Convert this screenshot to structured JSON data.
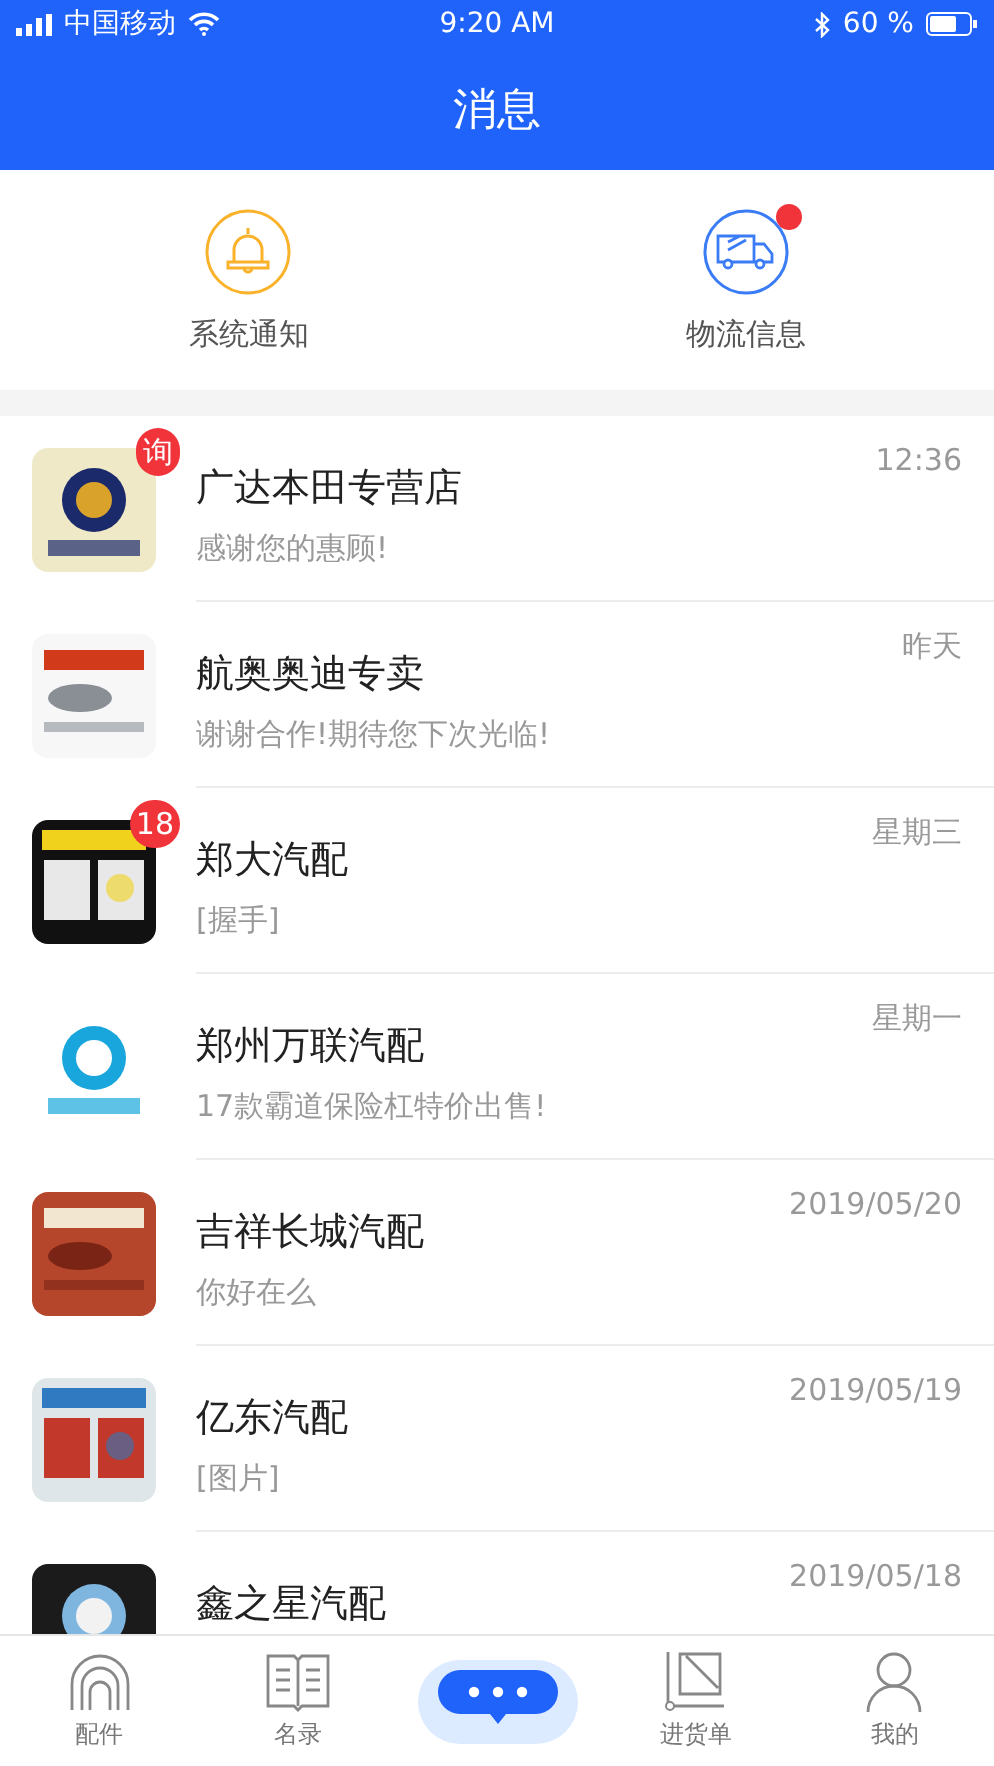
{
  "status_bar": {
    "carrier": "中国移动",
    "time": "9:20 AM",
    "battery": "60 %"
  },
  "header": {
    "title": "消息"
  },
  "shortcuts": [
    {
      "kind": "bell",
      "label": "系统通知",
      "dot": false
    },
    {
      "kind": "truck",
      "label": "物流信息",
      "dot": true
    }
  ],
  "conversations": [
    {
      "name": "广达本田专营店",
      "message": "感谢您的惠顾!",
      "time": "12:36",
      "badge": "询"
    },
    {
      "name": "航奥奥迪专卖",
      "message": "谢谢合作!期待您下次光临!",
      "time": "昨天"
    },
    {
      "name": "郑大汽配",
      "message": "[握手]",
      "time": "星期三",
      "badge": "18"
    },
    {
      "name": "郑州万联汽配",
      "message": "17款霸道保险杠特价出售!",
      "time": "星期一"
    },
    {
      "name": "吉祥长城汽配",
      "message": "你好在么",
      "time": "2019/05/20"
    },
    {
      "name": "亿东汽配",
      "message": "[图片]",
      "time": "2019/05/19"
    },
    {
      "name": "鑫之星汽配",
      "time": "2019/05/18"
    }
  ],
  "tab_bar": [
    {
      "kind": "headset",
      "label": "配件",
      "selected": false
    },
    {
      "kind": "book",
      "label": "名录",
      "selected": false
    },
    {
      "kind": "chat",
      "selected": true
    },
    {
      "kind": "order",
      "label": "进货单",
      "selected": false
    },
    {
      "kind": "person",
      "label": "我的",
      "selected": false
    }
  ]
}
